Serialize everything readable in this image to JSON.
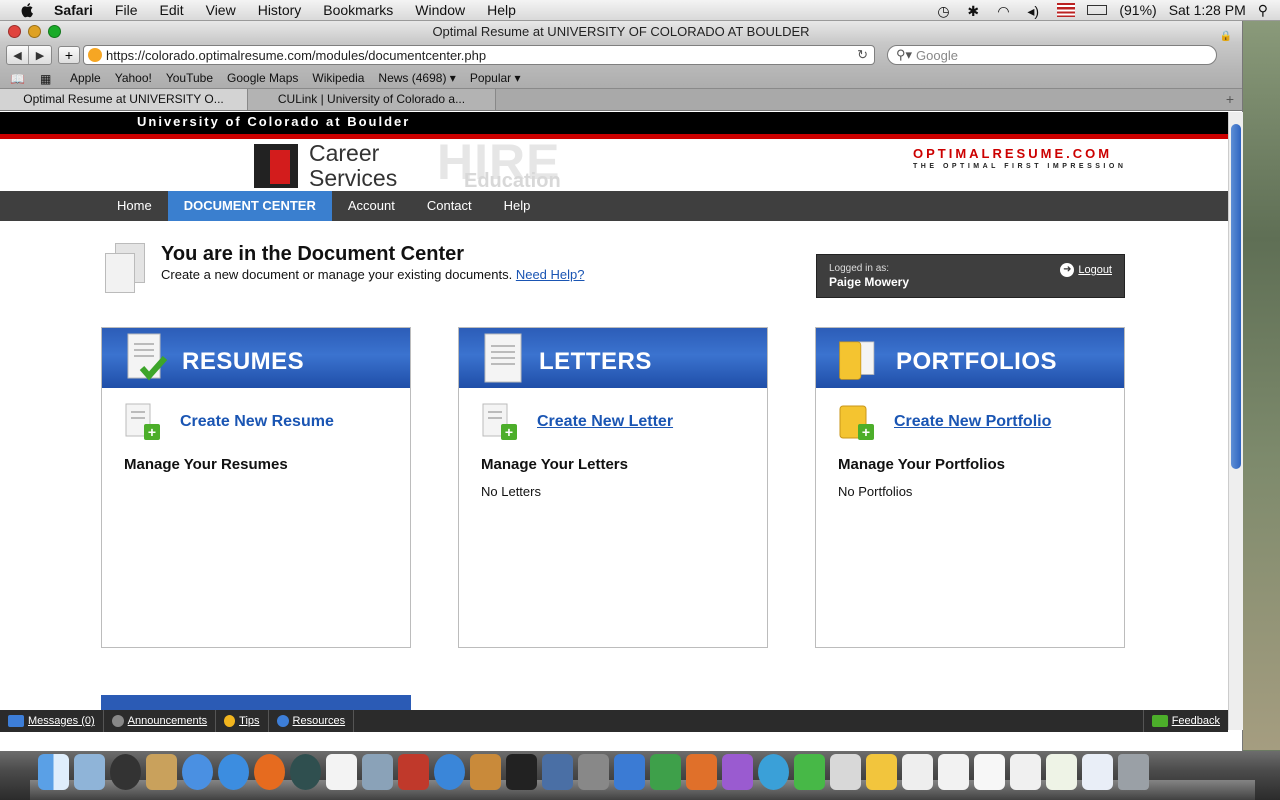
{
  "menubar": {
    "app": "Safari",
    "items": [
      "File",
      "Edit",
      "View",
      "History",
      "Bookmarks",
      "Window",
      "Help"
    ],
    "battery": "(91%)",
    "clock": "Sat 1:28 PM"
  },
  "window": {
    "title": "Optimal Resume at UNIVERSITY OF COLORADO AT BOULDER",
    "url": "https://colorado.optimalresume.com/modules/documentcenter.php",
    "search_placeholder": "Google",
    "bookmarks": [
      "Apple",
      "Yahoo!",
      "YouTube",
      "Google Maps",
      "Wikipedia",
      "News (4698) ▾",
      "Popular ▾"
    ],
    "tabs": [
      {
        "label": "Optimal Resume at UNIVERSITY O..."
      },
      {
        "label": "CULink | University of Colorado a..."
      }
    ]
  },
  "page": {
    "university": "University of Colorado at Boulder",
    "career_services": [
      "Career",
      "Services"
    ],
    "hire": "HIRE",
    "hire_sub": "Education",
    "brand": "OPTIMALRESUME.COM",
    "tagline": "THE OPTIMAL FIRST IMPRESSION",
    "nav": [
      "Home",
      "DOCUMENT CENTER",
      "Account",
      "Contact",
      "Help"
    ],
    "heading": "You are in the Document Center",
    "subheading": "Create a new document or manage your existing documents.",
    "help_link": "Need Help?",
    "login": {
      "label": "Logged in as:",
      "user": "Paige Mowery",
      "logout": "Logout"
    },
    "panels": [
      {
        "title": "RESUMES",
        "create": "Create New Resume",
        "manage": "Manage Your Resumes",
        "empty": ""
      },
      {
        "title": "LETTERS",
        "create": "Create New Letter",
        "manage": "Manage Your Letters",
        "empty": "No Letters"
      },
      {
        "title": "PORTFOLIOS",
        "create": "Create New Portfolio",
        "manage": "Manage Your Portfolios",
        "empty": "No Portfolios"
      }
    ],
    "bottombar": {
      "messages": "Messages (0)",
      "announcements": "Announcements",
      "tips": "Tips",
      "resources": "Resources",
      "feedback": "Feedback"
    }
  },
  "colors": {
    "accent_blue": "#3a7fcf",
    "brand_red": "#cc0000",
    "link_blue": "#1a55b3"
  }
}
